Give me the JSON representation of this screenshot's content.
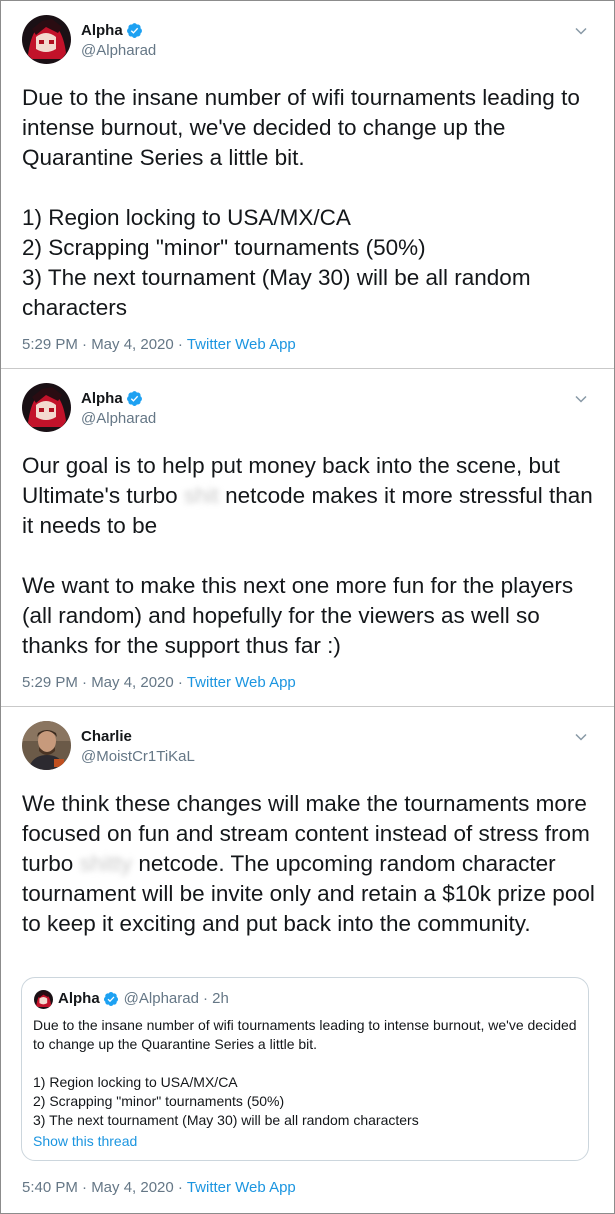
{
  "tweets": [
    {
      "name": "Alpha",
      "handle": "@Alpharad",
      "text_segments": [
        "Due to the insane number of wifi tournaments leading to intense burnout, we've decided to change up the Quarantine Series a little bit.\n\n1) Region locking to USA/MX/CA\n2) Scrapping \"minor\" tournaments (50%)\n3) The next tournament (May 30) will be all random characters"
      ],
      "time": "5:29 PM · May 4, 2020 · ",
      "app": "Twitter Web App"
    },
    {
      "name": "Alpha",
      "handle": "@Alpharad",
      "text_before": "Our goal is to help put money back into the scene, but Ultimate's turbo ",
      "censored": "shit",
      "text_after": " netcode makes it more stressful than it needs to be\n\nWe want to make this next one more fun for the players (all random) and hopefully for the viewers as well so thanks for the support thus far :)",
      "time": "5:29 PM · May 4, 2020 · ",
      "app": "Twitter Web App"
    },
    {
      "name": "Charlie",
      "handle": "@MoistCr1TiKaL",
      "text_before": "We think these changes will make the tournaments more focused on fun and stream content instead of stress from turbo ",
      "censored": "shitty",
      "text_after": " netcode. The upcoming random character tournament will be invite only and retain a $10k prize pool to keep it exciting and put back into the community.",
      "time": "5:40 PM · May 4, 2020 · ",
      "app": "Twitter Web App"
    }
  ],
  "quote": {
    "name": "Alpha",
    "handle": "@Alpharad",
    "age": "· 2h",
    "text": "Due to the insane number of wifi tournaments leading to intense burnout, we've decided to change up the Quarantine Series a little bit.\n\n1) Region locking to USA/MX/CA\n2) Scrapping \"minor\" tournaments (50%)\n3) The next tournament (May 30) will be all random characters",
    "show_thread": "Show this thread"
  },
  "icons": {
    "verified": "verified-badge-icon",
    "chevron": "chevron-down-icon"
  },
  "colors": {
    "accent": "#1b95e0",
    "verified": "#1da1f2",
    "secondary_text": "#657786"
  }
}
